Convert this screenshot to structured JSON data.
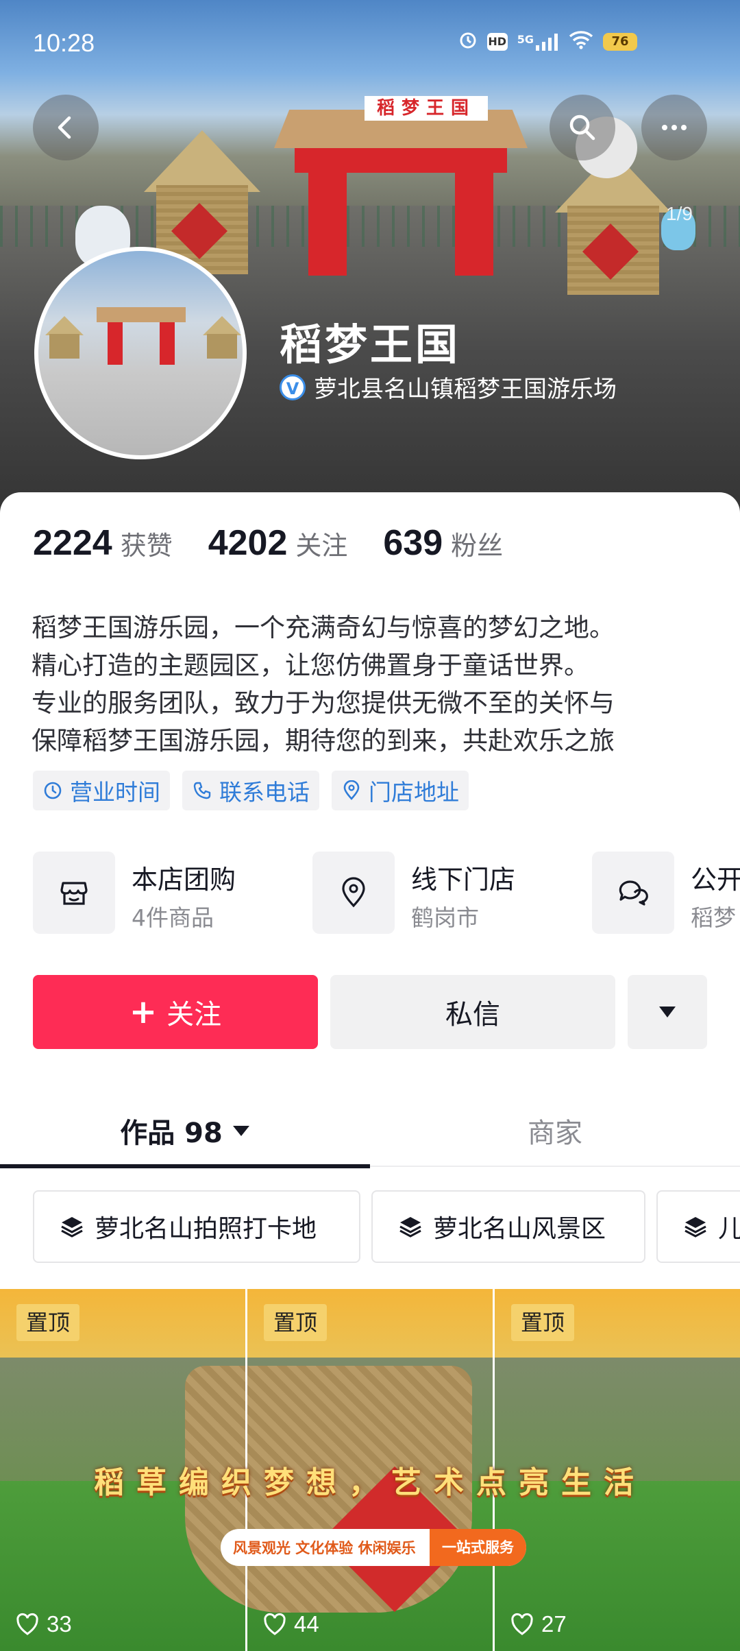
{
  "status_bar": {
    "time": "10:28",
    "hd": "HD",
    "network": "5G",
    "battery": "76"
  },
  "header": {
    "gallery_index": "1/9",
    "gate_sign": "稻梦王国"
  },
  "profile": {
    "name": "稻梦王国",
    "verify_badge": "V",
    "verified_title": "萝北县名山镇稻梦王国游乐场",
    "stats": [
      {
        "num": "2224",
        "label": "获赞"
      },
      {
        "num": "4202",
        "label": "关注"
      },
      {
        "num": "639",
        "label": "粉丝"
      }
    ],
    "bio_lines": [
      "稻梦王国游乐园，一个充满奇幻与惊喜的梦幻之地。",
      "精心打造的主题园区，让您仿佛置身于童话世界。",
      "专业的服务团队，致力于为您提供无微不至的关怀与",
      "保障稻梦王国游乐园，期待您的到来，共赴欢乐之旅"
    ],
    "tags": [
      "营业时间",
      "联系电话",
      "门店地址"
    ]
  },
  "services": [
    {
      "title": "本店团购",
      "sub": "4件商品"
    },
    {
      "title": "线下门店",
      "sub": "鹤岗市"
    },
    {
      "title": "公开",
      "sub": "稻梦"
    }
  ],
  "actions": {
    "follow": "关注",
    "follow_plus": "+",
    "message": "私信"
  },
  "tabs": {
    "works": "作品 98",
    "shop": "商家"
  },
  "collections": [
    "萝北名山拍照打卡地",
    "萝北名山风景区",
    "儿"
  ],
  "posts": [
    {
      "pin": "置顶",
      "likes": "33"
    },
    {
      "pin": "置顶",
      "likes": "44"
    },
    {
      "pin": "置顶",
      "likes": "27"
    }
  ],
  "post_banner": {
    "title": "稻草编织梦想，艺术点亮生活",
    "sub_left": "风景观光 文化体验 休闲娱乐",
    "sub_right": "一站式服务"
  },
  "colors": {
    "accent": "#fe2c55",
    "link": "#2f7cd8",
    "pin": "#f5d16c"
  }
}
